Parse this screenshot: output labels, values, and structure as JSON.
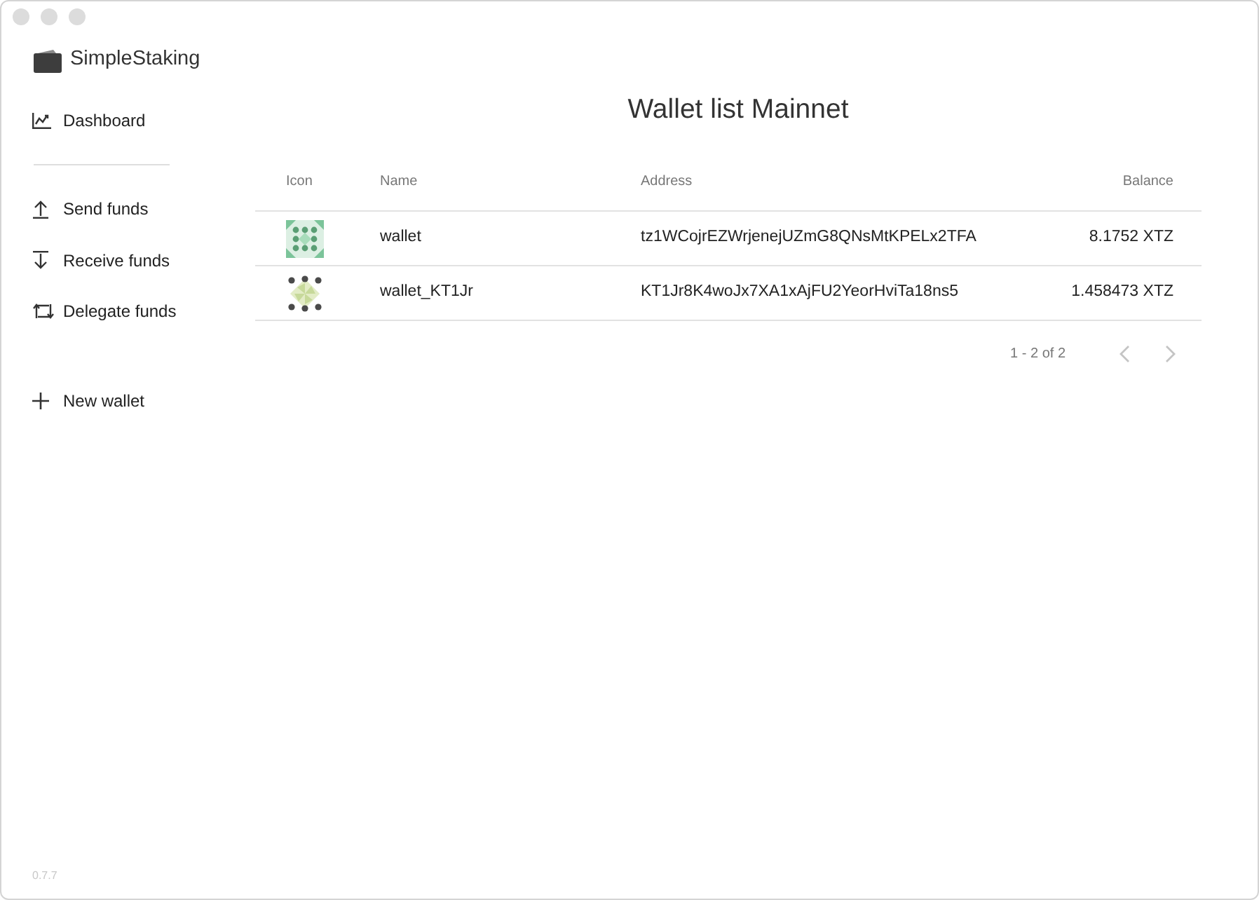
{
  "app": {
    "name": "SimpleStaking",
    "version": "0.7.7"
  },
  "sidebar": {
    "groups": [
      {
        "items": [
          {
            "label": "Dashboard"
          }
        ]
      },
      {
        "items": [
          {
            "label": "Send funds"
          },
          {
            "label": "Receive funds"
          },
          {
            "label": "Delegate funds"
          }
        ]
      },
      {
        "items": [
          {
            "label": "New wallet"
          }
        ]
      }
    ]
  },
  "page": {
    "title": "Wallet list Mainnet"
  },
  "table": {
    "columns": [
      "Icon",
      "Name",
      "Address",
      "Balance"
    ],
    "rows": [
      {
        "name": "wallet",
        "address": "tz1WCojrEZWrjenejUZmG8QNsMtKPELx2TFA",
        "balance": "8.1752 XTZ"
      },
      {
        "name": "wallet_KT1Jr",
        "address": "KT1Jr8K4woJx7XA1xAjFU2YeorHviTa18ns5",
        "balance": "1.458473 XTZ"
      }
    ]
  },
  "pagination": {
    "range": "1 - 2 of 2",
    "prev": {
      "disabled": true
    },
    "next": {
      "disabled": true
    }
  }
}
